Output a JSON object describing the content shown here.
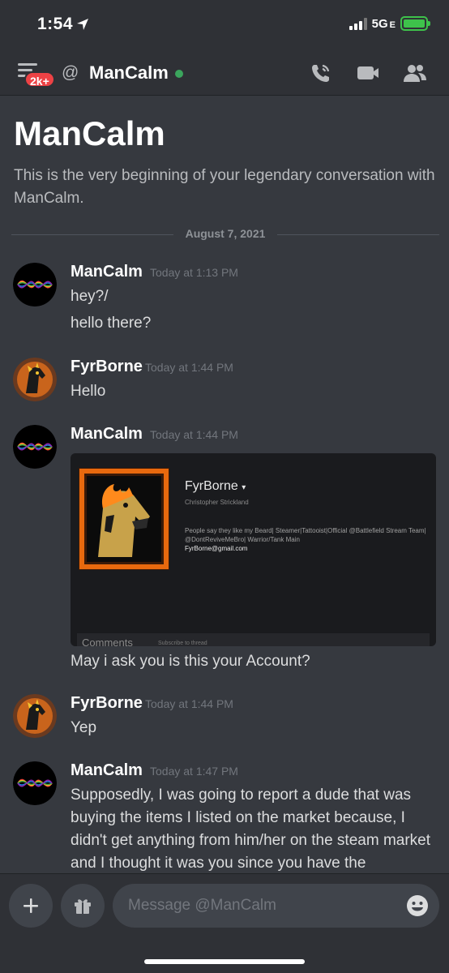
{
  "status_bar": {
    "time": "1:54",
    "network": "5G",
    "network_suffix": "E"
  },
  "header": {
    "badge": "2k+",
    "at_symbol": "@",
    "title": "ManCalm",
    "status_color": "#3ba55d",
    "icons": [
      "phone-call-icon",
      "video-camera-icon",
      "members-icon"
    ]
  },
  "intro": {
    "title": "ManCalm",
    "text": "This is the very beginning of your legendary conversation with ManCalm."
  },
  "date_divider": "August 7, 2021",
  "messages": [
    {
      "author": "ManCalm",
      "timestamp": "Today at 1:13 PM",
      "lines": [
        "hey?/",
        "hello there?"
      ]
    },
    {
      "author": "FyrBorne",
      "timestamp": "Today at 1:44 PM",
      "lines": [
        "Hello"
      ]
    },
    {
      "author": "ManCalm",
      "timestamp": "Today at 1:44 PM",
      "embed": {
        "name": "FyrBorne",
        "real_name": "Christopher Strickland",
        "bio": "People say they like my Beard| Steamer|Tattooist|Official @Battlefield Stream Team| @DontReviveMeBro| Warrior/Tank Main",
        "email": "FyrBorne@gmail.com",
        "footer_comments": "Comments",
        "footer_sub": "Subscribe to thread"
      },
      "lines": [
        "May i ask you is this your Account?"
      ]
    },
    {
      "author": "FyrBorne",
      "timestamp": "Today at 1:44 PM",
      "lines": [
        "Yep"
      ]
    },
    {
      "author": "ManCalm",
      "timestamp": "Today at 1:47 PM",
      "text": "Supposedly, I was going to report a dude that was buying the items I listed on the market because, I didn't get anything from him/her on the steam market and I thought it was you since you have the"
    }
  ],
  "composer": {
    "placeholder": "Message @ManCalm"
  },
  "colors": {
    "background": "#36393f",
    "header": "#2f3136",
    "input": "#40444b",
    "badge": "#ed4245"
  }
}
